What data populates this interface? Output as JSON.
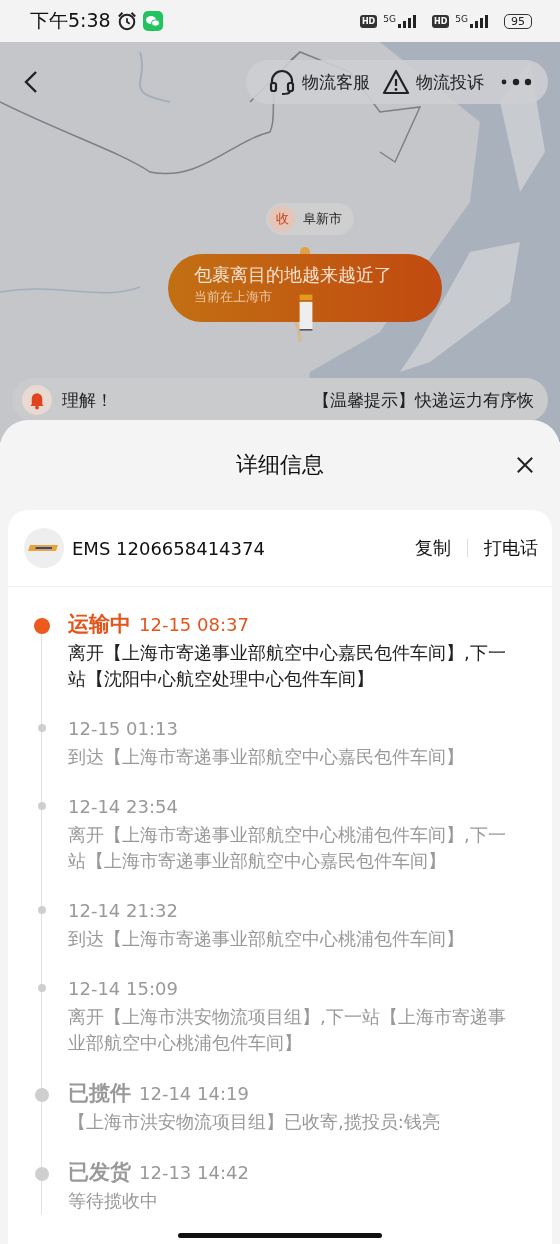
{
  "status_bar": {
    "time": "下午5:38",
    "sims": [
      {
        "badge": "HD",
        "network": "5G"
      },
      {
        "badge": "HD",
        "network": "5G"
      }
    ],
    "battery": "95"
  },
  "top_actions": [
    "物流客服",
    "物流投诉"
  ],
  "map": {
    "kind": "picture",
    "marker": {
      "badge": "收",
      "city": "阜新市"
    },
    "bubble": {
      "title": "包裹离目的地越来越近了",
      "subtitle": "当前在上海市"
    }
  },
  "notice": {
    "left_text": "理解！",
    "right_text": "【温馨提示】快递运力有序恢"
  },
  "sheet": {
    "title": "详细信息"
  },
  "carrier": {
    "tracking": "EMS 1206658414374",
    "actions": [
      "复制",
      "打电话"
    ]
  },
  "events": [
    {
      "kind": "current",
      "status": "运输中",
      "time": "12-15 08:37",
      "text": "离开【上海市寄递事业部航空中心嘉民包件车间】,下一站【沈阳中心航空处理中心包件车间】"
    },
    {
      "kind": "point",
      "time": "12-15 01:13",
      "text": "到达【上海市寄递事业部航空中心嘉民包件车间】"
    },
    {
      "kind": "point",
      "time": "12-14 23:54",
      "text": "离开【上海市寄递事业部航空中心桃浦包件车间】,下一站【上海市寄递事业部航空中心嘉民包件车间】"
    },
    {
      "kind": "point",
      "time": "12-14 21:32",
      "text": "到达【上海市寄递事业部航空中心桃浦包件车间】"
    },
    {
      "kind": "point",
      "time": "12-14 15:09",
      "text": "离开【上海市洪安物流项目组】,下一站【上海市寄递事业部航空中心桃浦包件车间】"
    },
    {
      "kind": "milestone",
      "status": "已揽件",
      "time": "12-14 14:19",
      "text": "【上海市洪安物流项目组】已收寄,揽投员:钱亮"
    },
    {
      "kind": "milestone",
      "status": "已发货",
      "time": "12-13 14:42",
      "text": "等待揽收中"
    }
  ]
}
